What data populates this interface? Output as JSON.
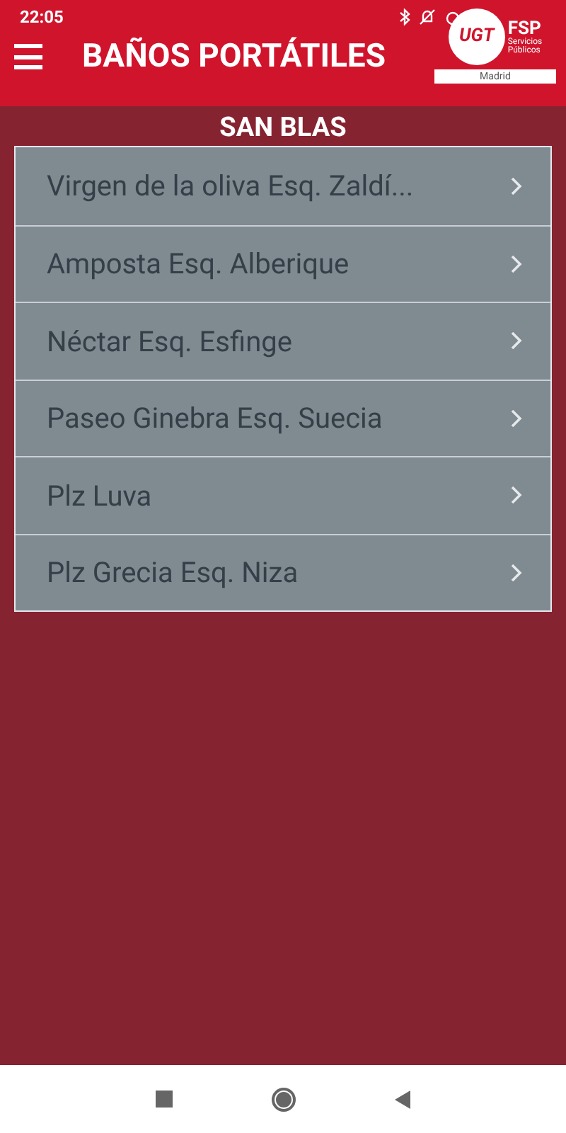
{
  "status_bar": {
    "time": "22:05"
  },
  "app_bar": {
    "title": "BAÑOS PORTÁTILES",
    "logo": {
      "letters": "UGT",
      "brand": "FSP",
      "line_1": "Servicios",
      "line_2": "Públicos",
      "region": "Madrid"
    }
  },
  "section": {
    "title": "SAN BLAS"
  },
  "items": [
    {
      "label": "Virgen de la oliva Esq. Zaldí..."
    },
    {
      "label": "Amposta Esq. Alberique"
    },
    {
      "label": "Néctar Esq. Esfinge"
    },
    {
      "label": "Paseo Ginebra Esq. Suecia"
    },
    {
      "label": "Plz Luva"
    },
    {
      "label": "Plz Grecia Esq. Niza"
    }
  ]
}
